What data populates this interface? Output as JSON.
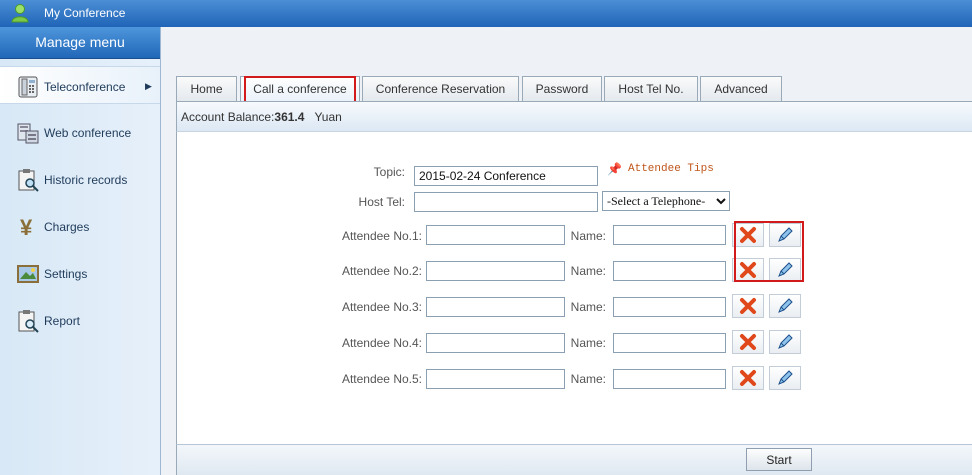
{
  "app": {
    "title": "My Conference"
  },
  "sidebar": {
    "header": "Manage menu",
    "items": [
      {
        "label": "Teleconference",
        "icon": "telephone-icon",
        "active": true
      },
      {
        "label": "Web conference",
        "icon": "server-icon"
      },
      {
        "label": "Historic records",
        "icon": "clipboard-search-icon"
      },
      {
        "label": "Charges",
        "icon": "yen-icon"
      },
      {
        "label": "Settings",
        "icon": "settings-picture-icon"
      },
      {
        "label": "Report",
        "icon": "report-icon"
      }
    ]
  },
  "tabs": [
    {
      "label": "Home"
    },
    {
      "label": "Call a conference",
      "active": true
    },
    {
      "label": "Conference Reservation"
    },
    {
      "label": "Password"
    },
    {
      "label": "Host Tel No."
    },
    {
      "label": "Advanced"
    }
  ],
  "balance": {
    "label": "Account Balance:",
    "value": "361.4",
    "unit": "Yuan"
  },
  "form": {
    "topic_label": "Topic:",
    "topic_value": "2015-02-24 Conference",
    "tips_label": "Attendee Tips",
    "host_tel_label": "Host Tel:",
    "host_tel_value": "",
    "telephone_select": "-Select a Telephone-",
    "name_label": "Name:",
    "attendees": [
      {
        "label": "Attendee No.1:",
        "number": "",
        "name": ""
      },
      {
        "label": "Attendee No.2:",
        "number": "",
        "name": ""
      },
      {
        "label": "Attendee No.3:",
        "number": "",
        "name": ""
      },
      {
        "label": "Attendee No.4:",
        "number": "",
        "name": ""
      },
      {
        "label": "Attendee No.5:",
        "number": "",
        "name": ""
      }
    ]
  },
  "footer": {
    "start_label": "Start"
  },
  "colors": {
    "highlight": "#d21a1a",
    "titlebar": "#2a6fc0",
    "tips": "#c0561b"
  }
}
